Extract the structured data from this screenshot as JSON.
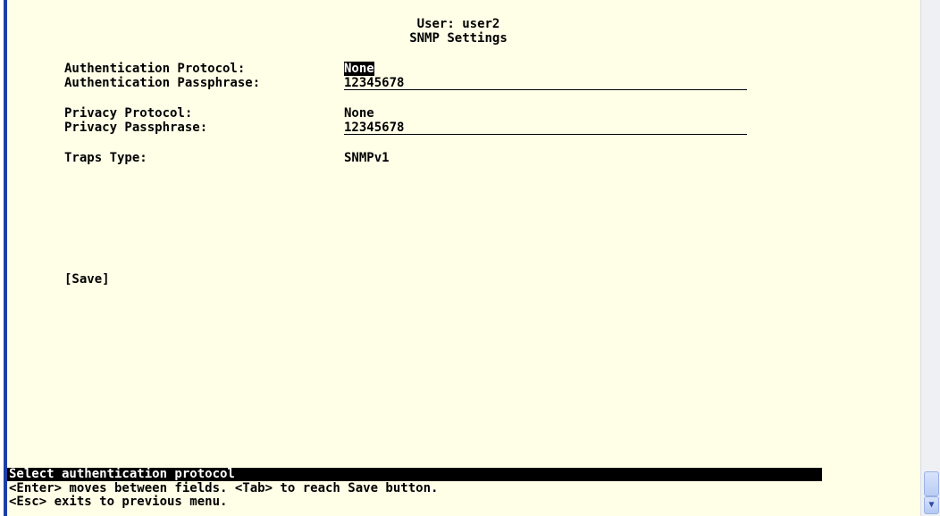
{
  "header": {
    "user_line": "User: user2",
    "title": "SNMP Settings"
  },
  "fields": {
    "auth_protocol": {
      "label": "Authentication Protocol:",
      "value": "None"
    },
    "auth_passphrase": {
      "label": "Authentication Passphrase:",
      "value": "12345678"
    },
    "privacy_protocol": {
      "label": "Privacy Protocol:",
      "value": "None"
    },
    "privacy_passphrase": {
      "label": "Privacy Passphrase:",
      "value": "12345678"
    },
    "traps_type": {
      "label": "Traps Type:",
      "value": "SNMPv1"
    }
  },
  "save_label": "[Save]",
  "footer": {
    "status": "Select authentication protocol",
    "help_line1": "<Enter> moves between fields. <Tab> to reach Save button.",
    "help_line2": "<Esc> exits to previous menu."
  },
  "colors": {
    "background": "#ffffe8",
    "text": "#000000",
    "highlight_bg": "#000000",
    "highlight_fg": "#ffffff",
    "left_bar": "#1c3fa8"
  },
  "icons": {
    "scroll_down": "chevron-down-icon"
  }
}
